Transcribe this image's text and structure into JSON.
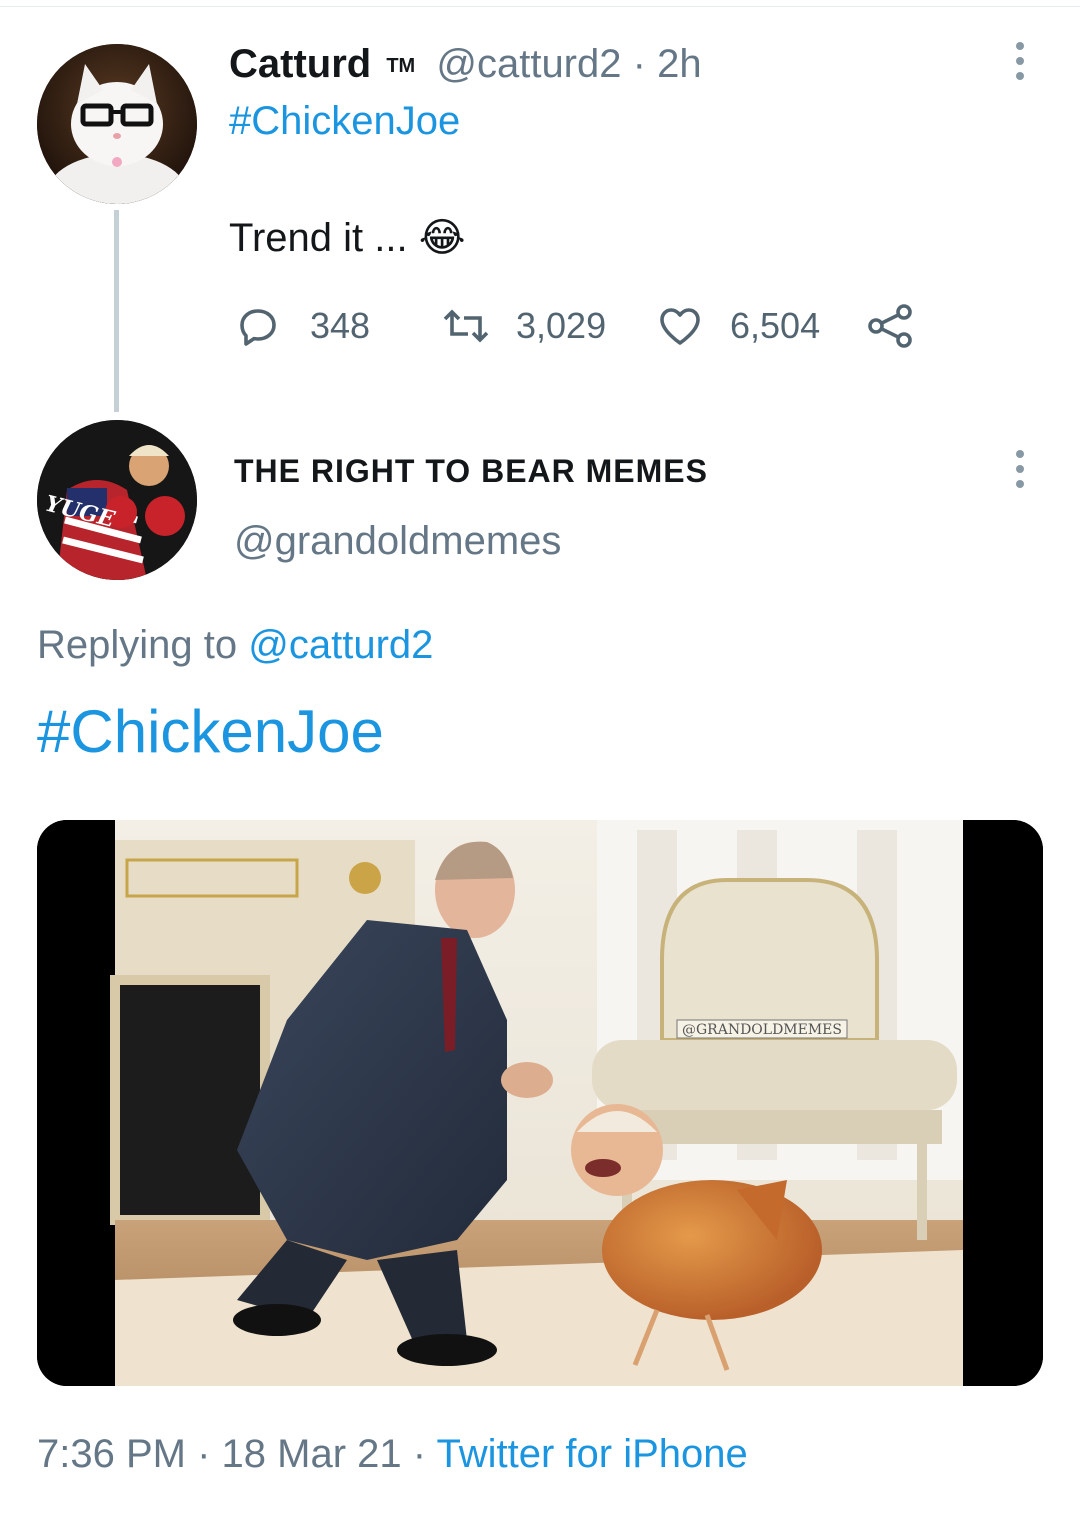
{
  "tweet": {
    "author_name": "Catturd",
    "author_mark": "TM",
    "author_handle": "@catturd2",
    "separator": "·",
    "time_ago": "2h",
    "hashtag": "#ChickenJoe",
    "text": "Trend it ...",
    "emoji": "😂",
    "stats": {
      "replies": "348",
      "retweets": "3,029",
      "likes": "6,504"
    }
  },
  "reply": {
    "author_name": "THE RIGHT TO BEAR MEMES",
    "author_handle": "@grandoldmemes",
    "avatar_text": "YUGE",
    "replying_prefix": "Replying to",
    "replying_handle": "@catturd2",
    "hashtag": "#ChickenJoe",
    "media_watermark": "@GRANDOLDMEMES",
    "timestamp_time": "7:36 PM",
    "separator": "·",
    "timestamp_date": "18 Mar 21",
    "source": "Twitter for iPhone"
  },
  "icons": {
    "reply": "reply-icon",
    "retweet": "retweet-icon",
    "like": "heart-icon",
    "share": "share-icon",
    "more": "more-icon"
  },
  "colors": {
    "link": "#1b95e0",
    "muted": "#657786",
    "thread_line": "#c4cfd6"
  }
}
